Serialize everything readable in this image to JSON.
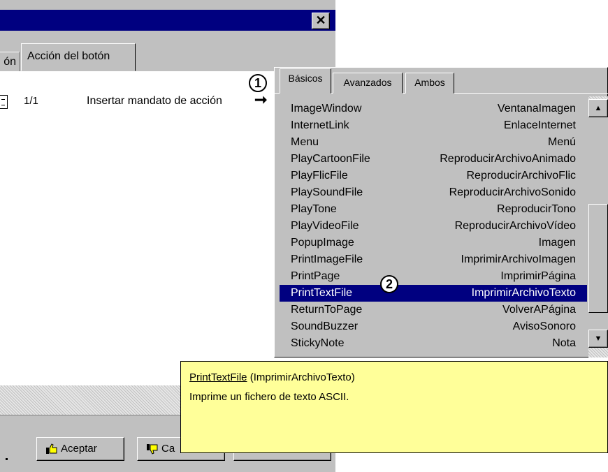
{
  "dialog": {
    "close_label": "✕",
    "tabs": [
      {
        "label": "ón"
      },
      {
        "label": "Acción del botón"
      }
    ],
    "command": {
      "index": "1/1",
      "text": "Insertar mandato de acción",
      "arrow": "➞"
    },
    "buttons": {
      "ok": "Aceptar",
      "cancel": "Ca"
    }
  },
  "popup": {
    "tabs": [
      "Básicos",
      "Avanzados",
      "Ambos"
    ],
    "items": [
      {
        "en": "ImageWindow",
        "es": "VentanaImagen"
      },
      {
        "en": "InternetLink",
        "es": "EnlaceInternet"
      },
      {
        "en": "Menu",
        "es": "Menú"
      },
      {
        "en": "PlayCartoonFile",
        "es": "ReproducirArchivoAnimado"
      },
      {
        "en": "PlayFlicFile",
        "es": "ReproducirArchivoFlic"
      },
      {
        "en": "PlaySoundFile",
        "es": "ReproducirArchivoSonido"
      },
      {
        "en": "PlayTone",
        "es": "ReproducirTono"
      },
      {
        "en": "PlayVideoFile",
        "es": "ReproducirArchivoVídeo"
      },
      {
        "en": "PopupImage",
        "es": "Imagen"
      },
      {
        "en": "PrintImageFile",
        "es": "ImprimirArchivoImagen"
      },
      {
        "en": "PrintPage",
        "es": "ImprimirPágina"
      },
      {
        "en": "PrintTextFile",
        "es": "ImprimirArchivoTexto"
      },
      {
        "en": "ReturnToPage",
        "es": "VolverAPágina"
      },
      {
        "en": "SoundBuzzer",
        "es": "AvisoSonoro"
      },
      {
        "en": "StickyNote",
        "es": "Nota"
      }
    ],
    "selected_index": 11,
    "scroll_up": "▲",
    "scroll_down": "▼"
  },
  "callouts": {
    "one": "1",
    "two": "2"
  },
  "tooltip": {
    "name": "PrintTextFile",
    "translation": " (ImprimirArchivoTexto)",
    "description": "Imprime un fichero de texto ASCII."
  },
  "colors": {
    "title_bar": "#000080",
    "selection": "#000080",
    "tooltip_bg": "#ffff99",
    "face": "#c0c0c0"
  }
}
